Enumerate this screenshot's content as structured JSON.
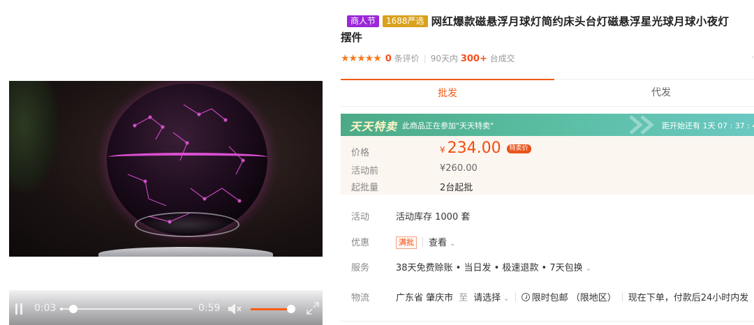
{
  "video": {
    "current_time": "0:03",
    "duration": "0:59",
    "progress_fraction": 0.05,
    "volume_fraction": 0.9
  },
  "product": {
    "tag_festival": "商人节",
    "tag_brand": "1688严选",
    "title_line1": "网红爆款磁悬浮月球灯简约床头台灯磁悬浮星光球月球小夜灯",
    "title_line2": "摆件",
    "stars": "★★★★★",
    "review_count": "0",
    "review_label": "条评价",
    "sales_prefix": "90天内",
    "sales_count": "300+",
    "sales_suffix": "台成交",
    "edge_glyph": "·"
  },
  "tabs": [
    {
      "label": "批发",
      "active": true
    },
    {
      "label": "代发",
      "active": false
    }
  ],
  "promo": {
    "logo": "天天特卖",
    "text": "此商品正在参加\"天天特卖\"",
    "countdown": "距开始还有 1天 07 : 37 : 4"
  },
  "pricing": {
    "price_label": "价格",
    "currency": "¥",
    "price": "234.00",
    "price_badge": "特卖价",
    "before_label": "活动前",
    "before_price": "¥260.00",
    "moq_label": "起批量",
    "moq": "2台起批"
  },
  "details": {
    "activity_label": "活动",
    "activity_value": "活动库存 1000 套",
    "discount_label": "优惠",
    "discount_chip": "满批",
    "discount_link": "查看",
    "service_label": "服务",
    "service_value": "38天免费赊账 • 当日发 • 极速退款 • 7天包换",
    "logistics_label": "物流",
    "logistics_from": "广东省 肇庆市",
    "logistics_to": "至",
    "logistics_select": "请选择",
    "logistics_free": "限时包邮 （限地区）",
    "logistics_note": "现在下单，付款后24小时内发"
  },
  "colors": {
    "accent": "#f25c19",
    "price": "#f04d10",
    "promo": "#4caa87",
    "festival_tag": "#9b27d8",
    "brand_tag": "#d9a11c"
  }
}
